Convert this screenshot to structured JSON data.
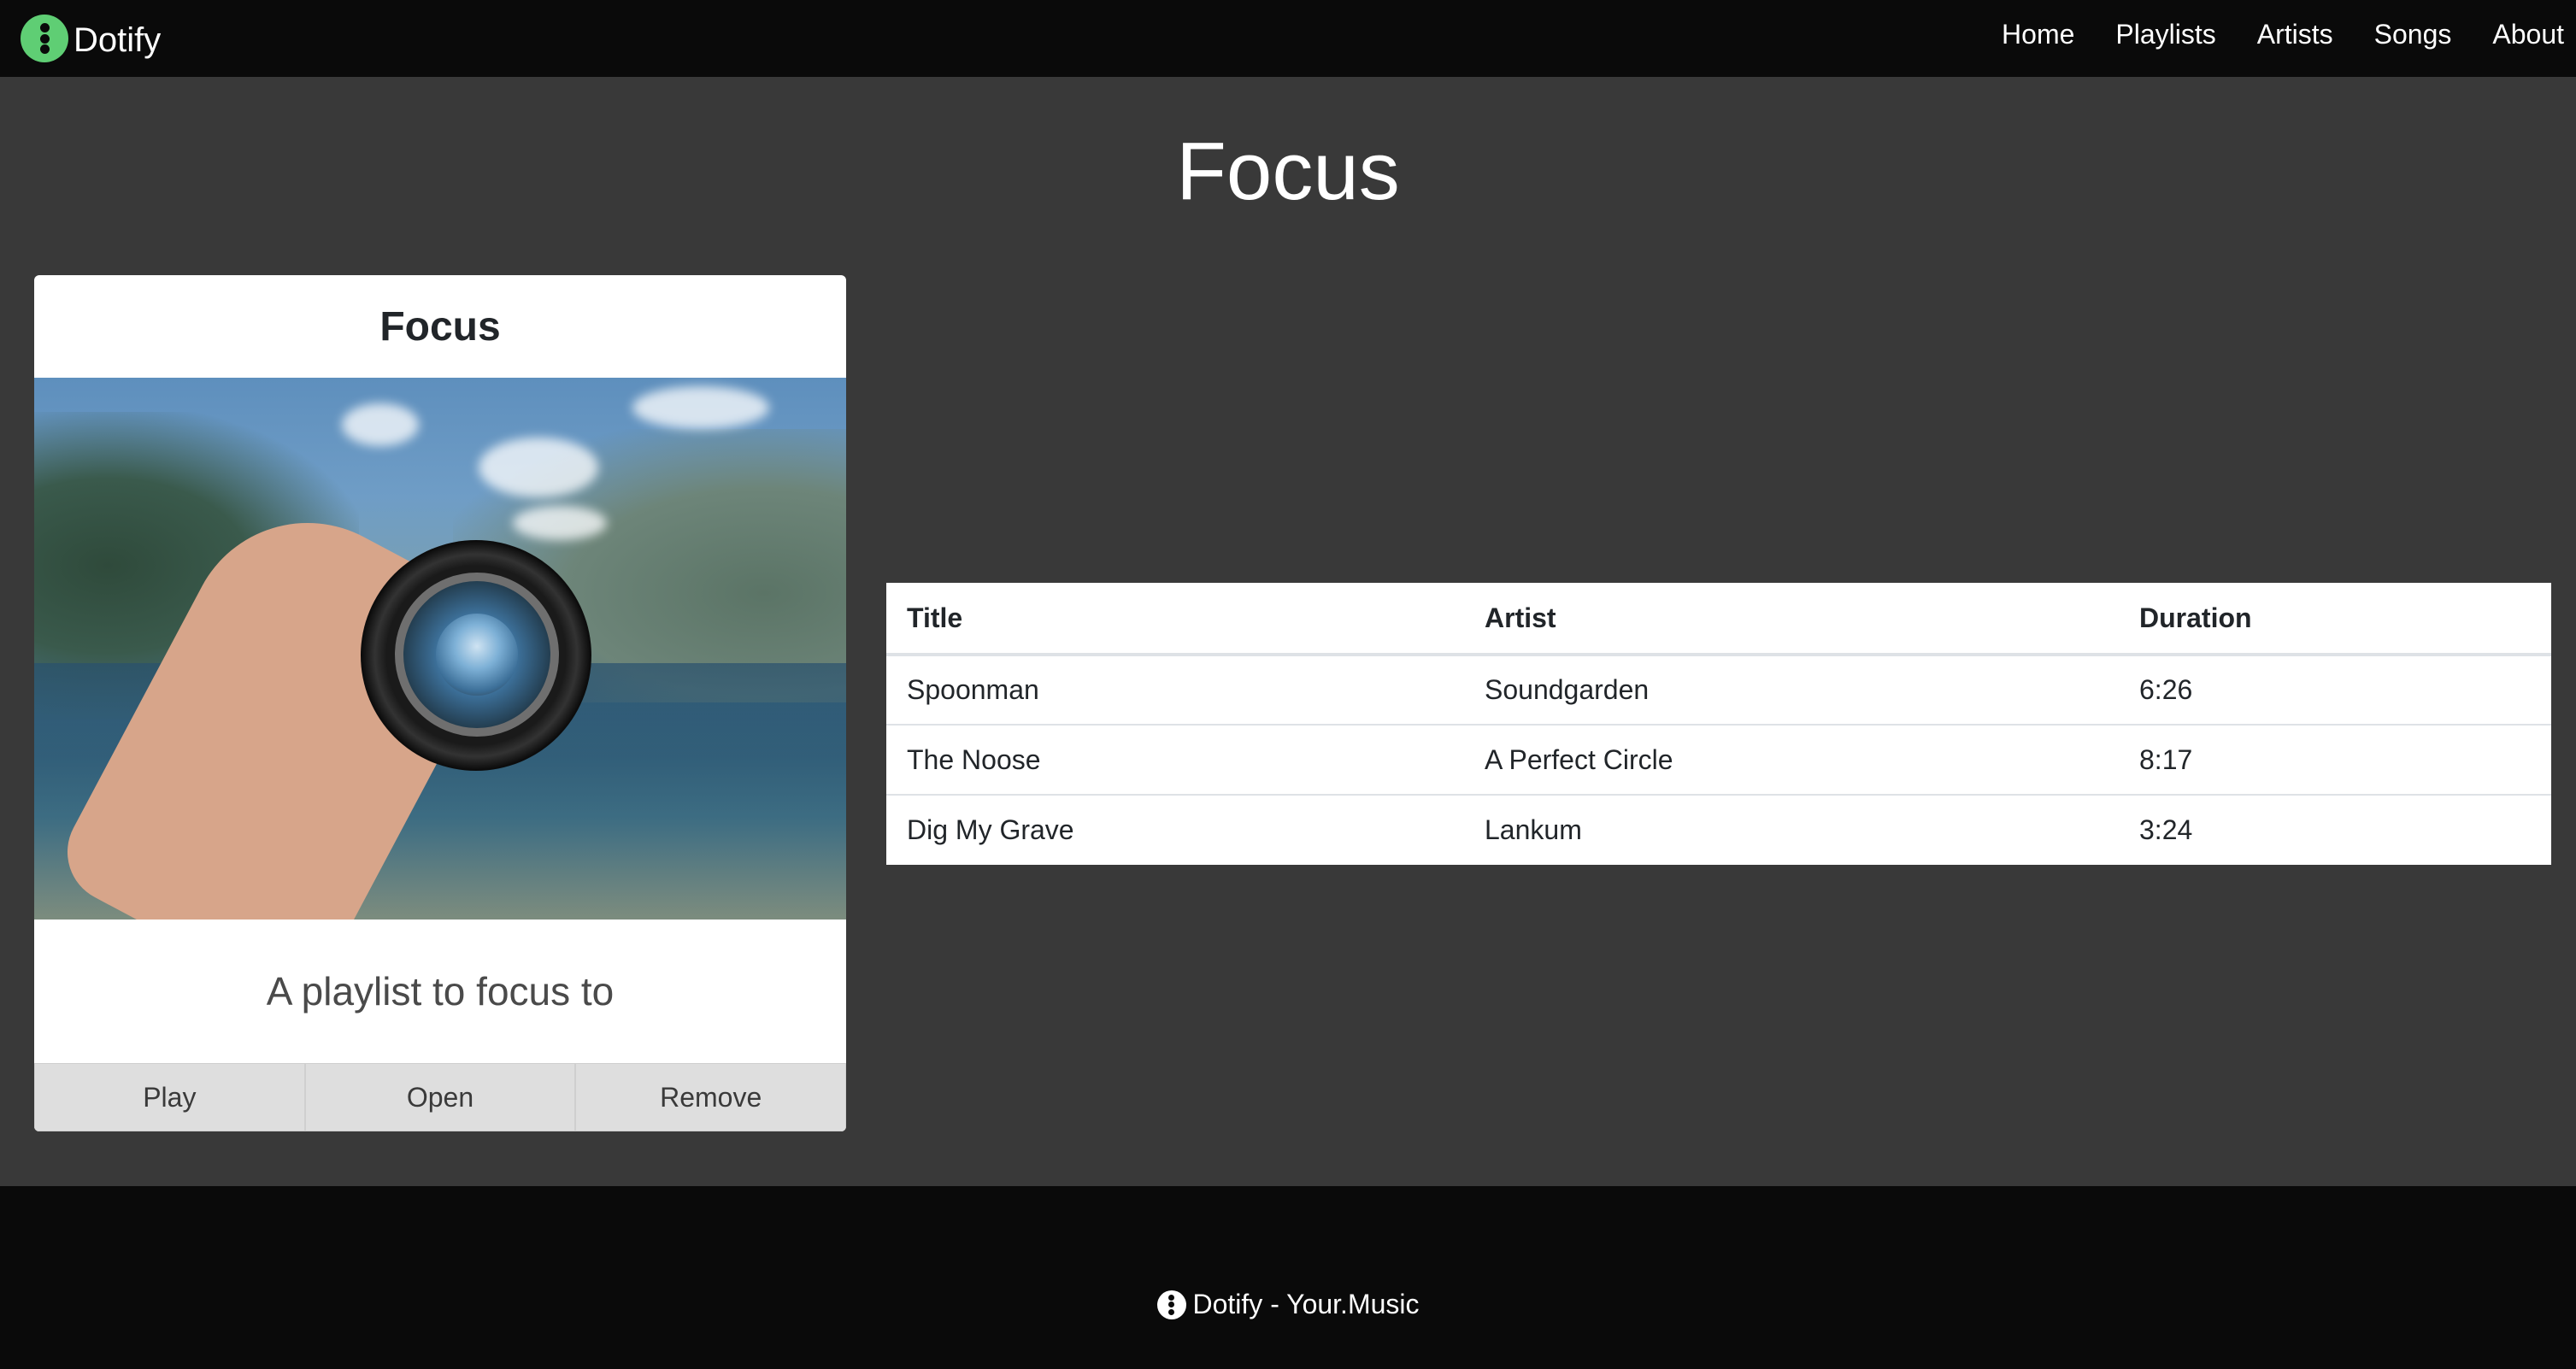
{
  "navbar": {
    "brand_name": "Dotify",
    "brand_icon": "dotify-logo-icon",
    "brand_color": "#5fce74",
    "links": [
      "Home",
      "Playlists",
      "Artists",
      "Songs",
      "About"
    ]
  },
  "page": {
    "title": "Focus",
    "background_color": "#393939"
  },
  "playlist_card": {
    "title": "Focus",
    "image": "camera-lens-over-lake-photo",
    "description": "A playlist to focus to",
    "buttons": [
      "Play",
      "Open",
      "Remove"
    ]
  },
  "songs_table": {
    "columns": [
      "Title",
      "Artist",
      "Duration"
    ],
    "rows": [
      {
        "title": "Spoonman",
        "artist": "Soundgarden",
        "duration": "6:26"
      },
      {
        "title": "The Noose",
        "artist": "A Perfect Circle",
        "duration": "8:17"
      },
      {
        "title": "Dig My Grave",
        "artist": "Lankum",
        "duration": "3:24"
      }
    ]
  },
  "footer": {
    "text": "Dotify - Your.Music",
    "icon": "dotify-logo-icon"
  }
}
